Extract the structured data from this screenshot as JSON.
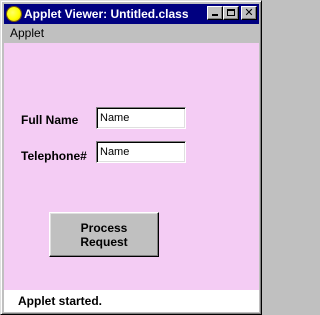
{
  "window": {
    "title": "Applet Viewer: Untitled.class",
    "icon": "java-applet-icon",
    "buttons": {
      "minimize": "minimize-icon",
      "maximize": "maximize-icon",
      "close": "close-icon",
      "close_glyph": "✕"
    }
  },
  "menubar": {
    "items": [
      {
        "label": "Applet"
      }
    ]
  },
  "applet": {
    "background_color": "#f4ccf4",
    "full_name_label": "Full Name",
    "full_name_value": "Name",
    "telephone_label": "Telephone#",
    "telephone_value": "Name",
    "process_button_label": "Process Request"
  },
  "status": {
    "text": "Applet started."
  }
}
